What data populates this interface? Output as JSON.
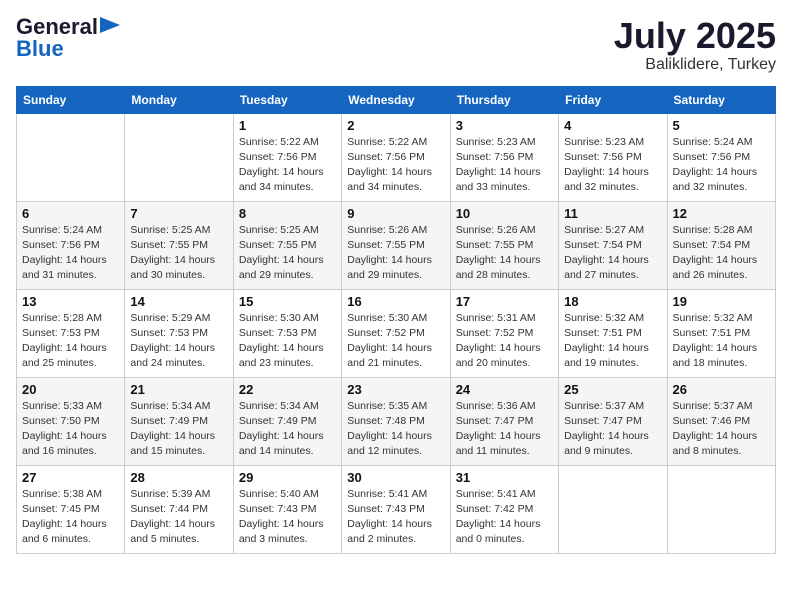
{
  "header": {
    "logo_general": "General",
    "logo_blue": "Blue",
    "title": "July 2025",
    "subtitle": "Baliklidere, Turkey"
  },
  "weekdays": [
    "Sunday",
    "Monday",
    "Tuesday",
    "Wednesday",
    "Thursday",
    "Friday",
    "Saturday"
  ],
  "weeks": [
    [
      {
        "day": "",
        "detail": ""
      },
      {
        "day": "",
        "detail": ""
      },
      {
        "day": "1",
        "detail": "Sunrise: 5:22 AM\nSunset: 7:56 PM\nDaylight: 14 hours and 34 minutes."
      },
      {
        "day": "2",
        "detail": "Sunrise: 5:22 AM\nSunset: 7:56 PM\nDaylight: 14 hours and 34 minutes."
      },
      {
        "day": "3",
        "detail": "Sunrise: 5:23 AM\nSunset: 7:56 PM\nDaylight: 14 hours and 33 minutes."
      },
      {
        "day": "4",
        "detail": "Sunrise: 5:23 AM\nSunset: 7:56 PM\nDaylight: 14 hours and 32 minutes."
      },
      {
        "day": "5",
        "detail": "Sunrise: 5:24 AM\nSunset: 7:56 PM\nDaylight: 14 hours and 32 minutes."
      }
    ],
    [
      {
        "day": "6",
        "detail": "Sunrise: 5:24 AM\nSunset: 7:56 PM\nDaylight: 14 hours and 31 minutes."
      },
      {
        "day": "7",
        "detail": "Sunrise: 5:25 AM\nSunset: 7:55 PM\nDaylight: 14 hours and 30 minutes."
      },
      {
        "day": "8",
        "detail": "Sunrise: 5:25 AM\nSunset: 7:55 PM\nDaylight: 14 hours and 29 minutes."
      },
      {
        "day": "9",
        "detail": "Sunrise: 5:26 AM\nSunset: 7:55 PM\nDaylight: 14 hours and 29 minutes."
      },
      {
        "day": "10",
        "detail": "Sunrise: 5:26 AM\nSunset: 7:55 PM\nDaylight: 14 hours and 28 minutes."
      },
      {
        "day": "11",
        "detail": "Sunrise: 5:27 AM\nSunset: 7:54 PM\nDaylight: 14 hours and 27 minutes."
      },
      {
        "day": "12",
        "detail": "Sunrise: 5:28 AM\nSunset: 7:54 PM\nDaylight: 14 hours and 26 minutes."
      }
    ],
    [
      {
        "day": "13",
        "detail": "Sunrise: 5:28 AM\nSunset: 7:53 PM\nDaylight: 14 hours and 25 minutes."
      },
      {
        "day": "14",
        "detail": "Sunrise: 5:29 AM\nSunset: 7:53 PM\nDaylight: 14 hours and 24 minutes."
      },
      {
        "day": "15",
        "detail": "Sunrise: 5:30 AM\nSunset: 7:53 PM\nDaylight: 14 hours and 23 minutes."
      },
      {
        "day": "16",
        "detail": "Sunrise: 5:30 AM\nSunset: 7:52 PM\nDaylight: 14 hours and 21 minutes."
      },
      {
        "day": "17",
        "detail": "Sunrise: 5:31 AM\nSunset: 7:52 PM\nDaylight: 14 hours and 20 minutes."
      },
      {
        "day": "18",
        "detail": "Sunrise: 5:32 AM\nSunset: 7:51 PM\nDaylight: 14 hours and 19 minutes."
      },
      {
        "day": "19",
        "detail": "Sunrise: 5:32 AM\nSunset: 7:51 PM\nDaylight: 14 hours and 18 minutes."
      }
    ],
    [
      {
        "day": "20",
        "detail": "Sunrise: 5:33 AM\nSunset: 7:50 PM\nDaylight: 14 hours and 16 minutes."
      },
      {
        "day": "21",
        "detail": "Sunrise: 5:34 AM\nSunset: 7:49 PM\nDaylight: 14 hours and 15 minutes."
      },
      {
        "day": "22",
        "detail": "Sunrise: 5:34 AM\nSunset: 7:49 PM\nDaylight: 14 hours and 14 minutes."
      },
      {
        "day": "23",
        "detail": "Sunrise: 5:35 AM\nSunset: 7:48 PM\nDaylight: 14 hours and 12 minutes."
      },
      {
        "day": "24",
        "detail": "Sunrise: 5:36 AM\nSunset: 7:47 PM\nDaylight: 14 hours and 11 minutes."
      },
      {
        "day": "25",
        "detail": "Sunrise: 5:37 AM\nSunset: 7:47 PM\nDaylight: 14 hours and 9 minutes."
      },
      {
        "day": "26",
        "detail": "Sunrise: 5:37 AM\nSunset: 7:46 PM\nDaylight: 14 hours and 8 minutes."
      }
    ],
    [
      {
        "day": "27",
        "detail": "Sunrise: 5:38 AM\nSunset: 7:45 PM\nDaylight: 14 hours and 6 minutes."
      },
      {
        "day": "28",
        "detail": "Sunrise: 5:39 AM\nSunset: 7:44 PM\nDaylight: 14 hours and 5 minutes."
      },
      {
        "day": "29",
        "detail": "Sunrise: 5:40 AM\nSunset: 7:43 PM\nDaylight: 14 hours and 3 minutes."
      },
      {
        "day": "30",
        "detail": "Sunrise: 5:41 AM\nSunset: 7:43 PM\nDaylight: 14 hours and 2 minutes."
      },
      {
        "day": "31",
        "detail": "Sunrise: 5:41 AM\nSunset: 7:42 PM\nDaylight: 14 hours and 0 minutes."
      },
      {
        "day": "",
        "detail": ""
      },
      {
        "day": "",
        "detail": ""
      }
    ]
  ]
}
